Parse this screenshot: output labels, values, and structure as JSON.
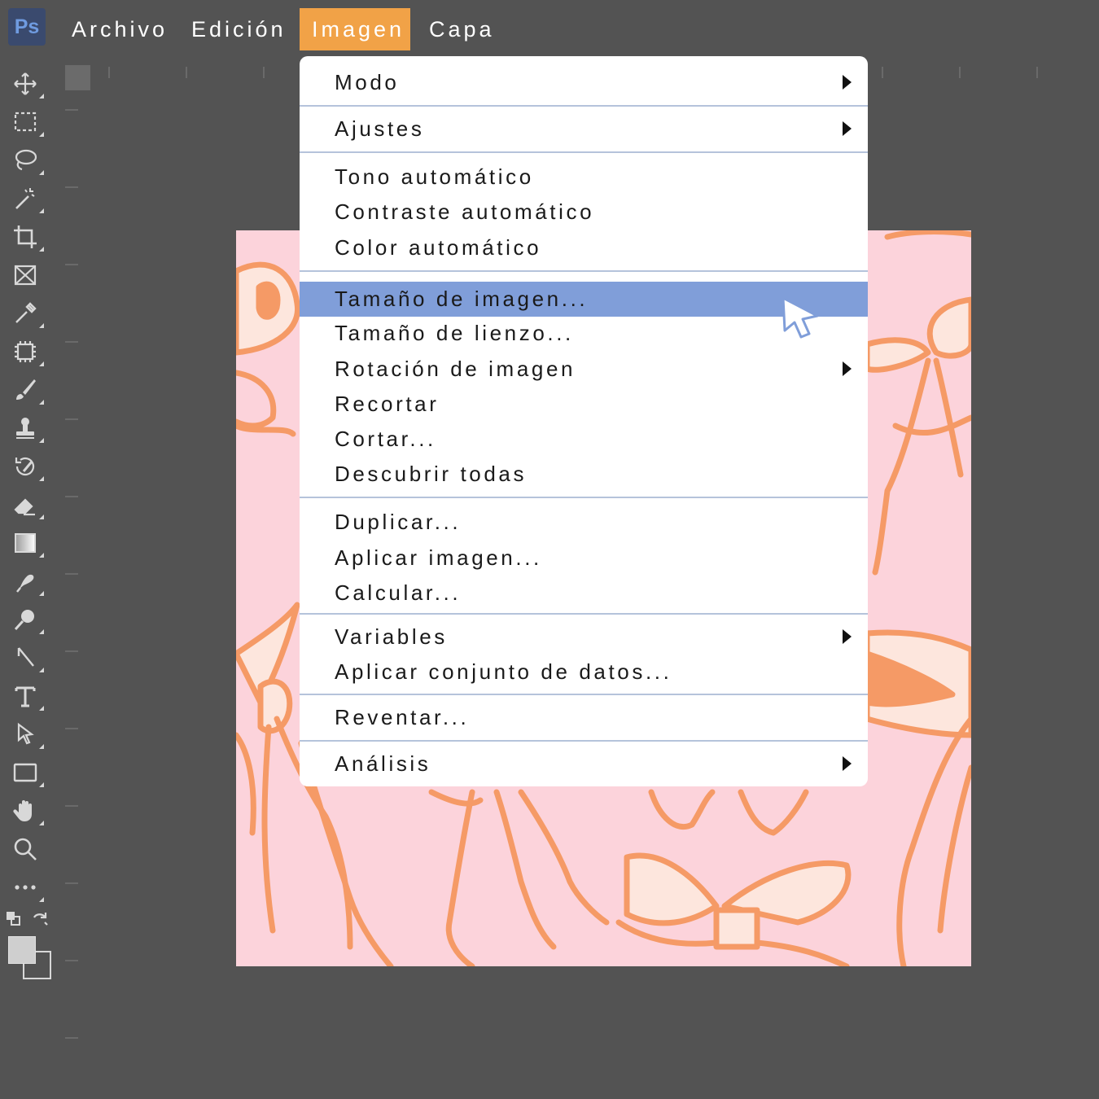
{
  "app": {
    "logo_text": "Ps"
  },
  "menubar": {
    "items": [
      {
        "label": "Archivo"
      },
      {
        "label": "Edición"
      },
      {
        "label": "Imagen",
        "active": true
      },
      {
        "label": "Capa"
      }
    ],
    "active_color": "#f1a247"
  },
  "toolbar": {
    "tools": [
      "move-tool-icon",
      "marquee-tool-icon",
      "lasso-tool-icon",
      "magic-wand-tool-icon",
      "crop-tool-icon",
      "frame-tool-icon",
      "eyedropper-tool-icon",
      "spot-healing-tool-icon",
      "brush-tool-icon",
      "clone-stamp-tool-icon",
      "history-brush-tool-icon",
      "eraser-tool-icon",
      "gradient-tool-icon",
      "smudge-tool-icon",
      "dodge-tool-icon",
      "pen-tool-icon",
      "type-tool-icon",
      "path-selection-tool-icon",
      "rectangle-tool-icon",
      "hand-tool-icon",
      "zoom-tool-icon",
      "more-tools-icon"
    ]
  },
  "dropdown": {
    "items": {
      "modo": {
        "label": "Modo"
      },
      "ajustes": {
        "label": "Ajustes"
      },
      "tono": {
        "label": "Tono automático"
      },
      "contraste": {
        "label": "Contraste automático"
      },
      "color": {
        "label": "Color automático"
      },
      "tamano_imagen": {
        "label": "Tamaño de imagen...",
        "highlighted": true
      },
      "tamano_lienzo": {
        "label": "Tamaño de lienzo..."
      },
      "rotacion": {
        "label": "Rotación de imagen"
      },
      "recortar": {
        "label": "Recortar"
      },
      "cortar": {
        "label": "Cortar..."
      },
      "descubrir": {
        "label": "Descubrir todas"
      },
      "duplicar": {
        "label": "Duplicar..."
      },
      "aplicar_imagen": {
        "label": "Aplicar imagen..."
      },
      "calcular": {
        "label": "Calcular..."
      },
      "variables": {
        "label": "Variables"
      },
      "aplicar_conjunto": {
        "label": "Aplicar conjunto de datos..."
      },
      "reventar": {
        "label": "Reventar..."
      },
      "analisis": {
        "label": "Análisis"
      }
    },
    "highlight_color": "#809ed9"
  },
  "canvas": {
    "background": "#fcd3db",
    "pattern": "bows",
    "stroke_color": "#f59a66",
    "fill_color": "#fde6dd"
  }
}
